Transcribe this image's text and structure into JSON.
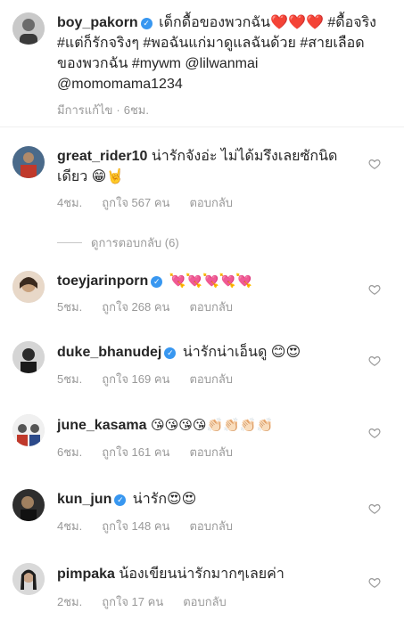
{
  "caption": {
    "username": "boy_pakorn",
    "text": "เด็กดื้อของพวกฉัน❤️❤️❤️ #ดื้อจริง #แต่ก็รักจริงๆ #พอฉันแก่มาดูแลฉันด้วย #สายเลือดของพวกฉัน #mywm @lilwanmai @momomama1234",
    "edited": "มีการแก้ไข",
    "time": "6ชม."
  },
  "view_replies": "ดูการตอบกลับ (6)",
  "comments": [
    {
      "username": "great_rider10",
      "verified": false,
      "text": "น่ารักจังอ่ะ ไม่ได้มรึงเลยซักนิดเดียว 😁🤘",
      "time": "4ชม.",
      "likes": "ถูกใจ 567 คน",
      "reply": "ตอบกลับ"
    },
    {
      "username": "toeyjarinporn",
      "verified": true,
      "text": "💘💘💘💘💘",
      "time": "5ชม.",
      "likes": "ถูกใจ 268 คน",
      "reply": "ตอบกลับ"
    },
    {
      "username": "duke_bhanudej",
      "verified": true,
      "text": "น่ารักน่าเอ็นดู 😊😍",
      "time": "5ชม.",
      "likes": "ถูกใจ 169 คน",
      "reply": "ตอบกลับ"
    },
    {
      "username": "june_kasama",
      "verified": false,
      "text": "😘😘😘😘👏🏻👏🏻👏🏻👏🏻",
      "time": "6ชม.",
      "likes": "ถูกใจ 161 คน",
      "reply": "ตอบกลับ"
    },
    {
      "username": "kun_jun",
      "verified": true,
      "text": "น่ารัก😍😍",
      "time": "4ชม.",
      "likes": "ถูกใจ 148 คน",
      "reply": "ตอบกลับ"
    },
    {
      "username": "pimpaka",
      "verified": false,
      "text": "น้องเขียนน่ารักมากๆเลยค่า",
      "time": "2ชม.",
      "likes": "ถูกใจ 17 คน",
      "reply": "ตอบกลับ"
    }
  ]
}
